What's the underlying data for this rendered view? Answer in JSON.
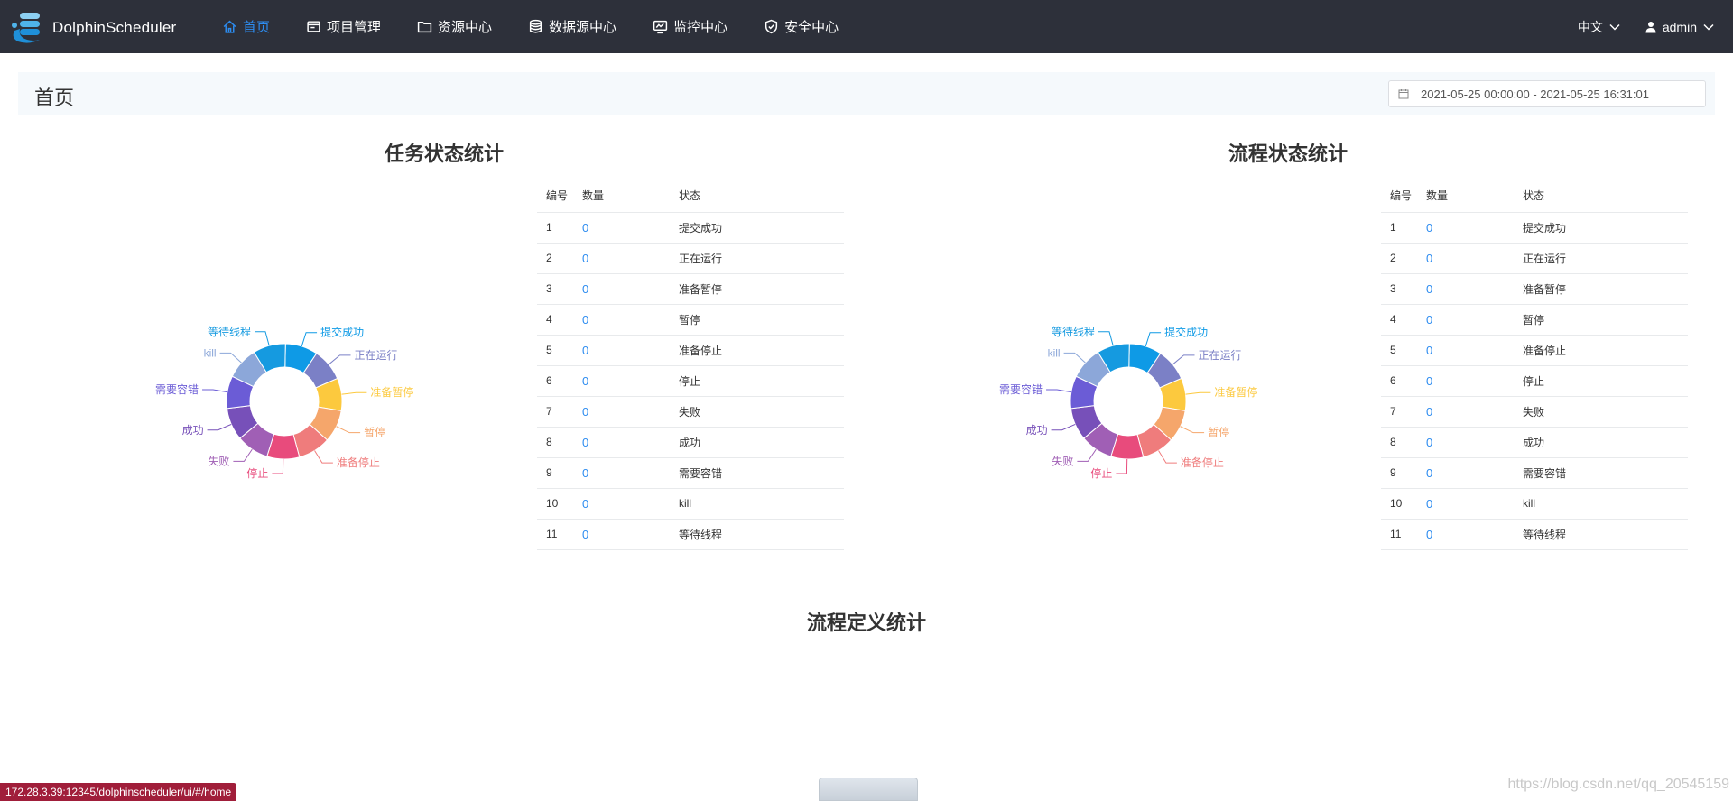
{
  "app": {
    "name": "DolphinScheduler"
  },
  "nav": {
    "items": [
      {
        "label": "首页",
        "icon": "home-icon",
        "active": true
      },
      {
        "label": "项目管理",
        "icon": "project-icon",
        "active": false
      },
      {
        "label": "资源中心",
        "icon": "folder-icon",
        "active": false
      },
      {
        "label": "数据源中心",
        "icon": "database-icon",
        "active": false
      },
      {
        "label": "监控中心",
        "icon": "monitor-icon",
        "active": false
      },
      {
        "label": "安全中心",
        "icon": "shield-icon",
        "active": false
      }
    ],
    "language": "中文",
    "user": "admin"
  },
  "page": {
    "title": "首页",
    "date_range": "2021-05-25 00:00:00 - 2021-05-25 16:31:01"
  },
  "sections": {
    "task_state_title": "任务状态统计",
    "process_state_title": "流程状态统计",
    "process_definition_title": "流程定义统计"
  },
  "table": {
    "headers": [
      "编号",
      "数量",
      "状态"
    ],
    "task_rows": [
      {
        "id": "1",
        "count": "0",
        "state": "提交成功"
      },
      {
        "id": "2",
        "count": "0",
        "state": "正在运行"
      },
      {
        "id": "3",
        "count": "0",
        "state": "准备暂停"
      },
      {
        "id": "4",
        "count": "0",
        "state": "暂停"
      },
      {
        "id": "5",
        "count": "0",
        "state": "准备停止"
      },
      {
        "id": "6",
        "count": "0",
        "state": "停止"
      },
      {
        "id": "7",
        "count": "0",
        "state": "失败"
      },
      {
        "id": "8",
        "count": "0",
        "state": "成功"
      },
      {
        "id": "9",
        "count": "0",
        "state": "需要容错"
      },
      {
        "id": "10",
        "count": "0",
        "state": "kill"
      },
      {
        "id": "11",
        "count": "0",
        "state": "等待线程"
      }
    ],
    "process_rows": [
      {
        "id": "1",
        "count": "0",
        "state": "提交成功"
      },
      {
        "id": "2",
        "count": "0",
        "state": "正在运行"
      },
      {
        "id": "3",
        "count": "0",
        "state": "准备暂停"
      },
      {
        "id": "4",
        "count": "0",
        "state": "暂停"
      },
      {
        "id": "5",
        "count": "0",
        "state": "准备停止"
      },
      {
        "id": "6",
        "count": "0",
        "state": "停止"
      },
      {
        "id": "7",
        "count": "0",
        "state": "失败"
      },
      {
        "id": "8",
        "count": "0",
        "state": "成功"
      },
      {
        "id": "9",
        "count": "0",
        "state": "需要容错"
      },
      {
        "id": "10",
        "count": "0",
        "state": "kill"
      },
      {
        "id": "11",
        "count": "0",
        "state": "等待线程"
      }
    ]
  },
  "pie": {
    "labels": [
      "提交成功",
      "正在运行",
      "准备暂停",
      "暂停",
      "准备停止",
      "停止",
      "失败",
      "成功",
      "需要容错",
      "kill",
      "等待线程"
    ],
    "colors": [
      "#0e9ae6",
      "#7b80c6",
      "#fcc93e",
      "#f5a66b",
      "#ef7c7c",
      "#e84b7c",
      "#a05fb5",
      "#7750b9",
      "#6b5cd6",
      "#8ca7d9",
      "#159ae0"
    ],
    "values": [
      0,
      0,
      0,
      0,
      0,
      0,
      0,
      0,
      0,
      0,
      0
    ]
  },
  "footer": {
    "status_url": "172.28.3.39:12345/dolphinscheduler/ui/#/home",
    "watermark": "https://blog.csdn.net/qq_20545159"
  }
}
